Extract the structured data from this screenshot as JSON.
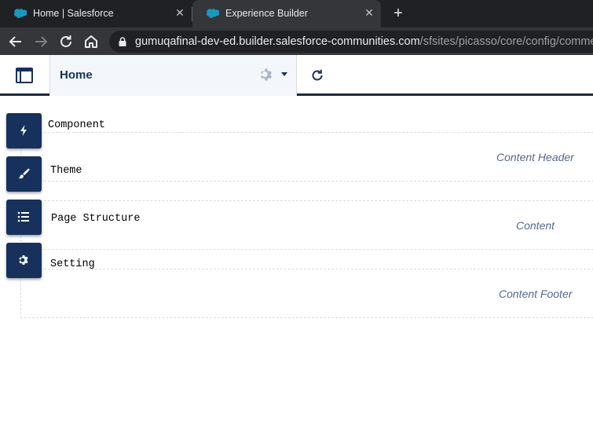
{
  "browser": {
    "tabs": [
      {
        "title": "Home | Salesforce",
        "active": false
      },
      {
        "title": "Experience Builder",
        "active": true
      }
    ],
    "url_host": "gumuqafinal-dev-ed.builder.salesforce-communities.com",
    "url_path": "/sfsites/picasso/core/config/commed",
    "colors": {
      "chrome_dark": "#202124",
      "chrome_toolbar": "#35363a",
      "salesforce_blue": "#1798c1"
    }
  },
  "header": {
    "page_name": "Home",
    "colors": {
      "navy": "#16325c",
      "header_rule": "#1b2b40"
    }
  },
  "rail": {
    "items": [
      {
        "label": "Component",
        "icon": "lightning-bolt-icon"
      },
      {
        "label": "Theme",
        "icon": "paintbrush-icon"
      },
      {
        "label": "Page Structure",
        "icon": "list-icon"
      },
      {
        "label": "Setting",
        "icon": "gear-icon"
      }
    ]
  },
  "canvas": {
    "regions": [
      {
        "label": "Content Header"
      },
      {
        "label": "Content"
      },
      {
        "label": "Content Footer"
      }
    ]
  }
}
